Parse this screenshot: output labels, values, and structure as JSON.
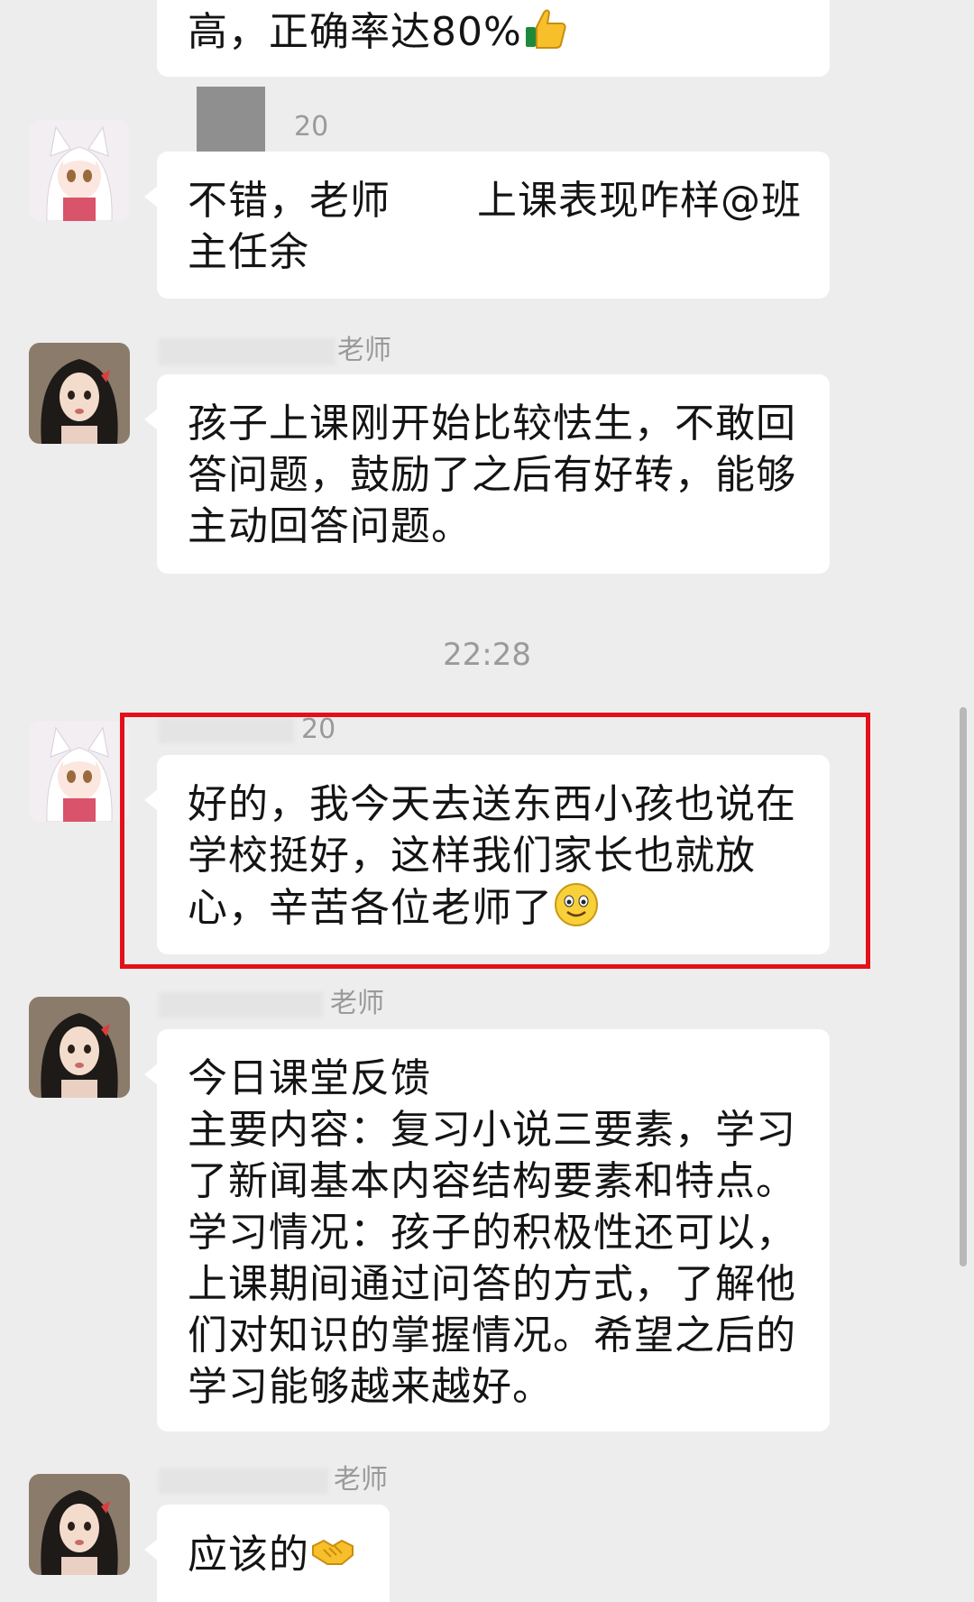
{
  "messages": [
    {
      "id": "m1",
      "lines": [
        "高，正确率达80%"
      ],
      "emoji": "thumbs-up"
    },
    {
      "id": "m2",
      "sender": "20",
      "lines": [
        "不错，老师",
        "上课表现咋样@班",
        "主任余"
      ]
    },
    {
      "id": "m3",
      "sender": "老师",
      "lines": [
        "孩子上课刚开始比较怯生，不敢回",
        "答问题，鼓励了之后有好转，能够",
        "主动回答问题。"
      ]
    },
    {
      "id": "m4",
      "sender": "20",
      "lines": [
        "好的，我今天去送东西小孩也说在",
        "学校挺好，这样我们家长也就放",
        "心，辛苦各位老师了"
      ],
      "emoji": "smiley"
    },
    {
      "id": "m5",
      "sender": "老师",
      "lines": [
        "今日课堂反馈",
        "主要内容：复习小说三要素，学习",
        "了新闻基本内容结构要素和特点。",
        "学习情况：孩子的积极性还可以，",
        "上课期间通过问答的方式，了解他",
        "们对知识的掌握情况。希望之后的",
        "学习能够越来越好。"
      ]
    },
    {
      "id": "m6",
      "sender": "老师",
      "lines": [
        "应该的"
      ],
      "emoji": "handshake"
    }
  ],
  "timestamp": "22:28",
  "colors": {
    "background": "#ededed",
    "bubble": "#ffffff",
    "highlight_border": "#e3101a",
    "meta_text": "#9a9a9a"
  }
}
